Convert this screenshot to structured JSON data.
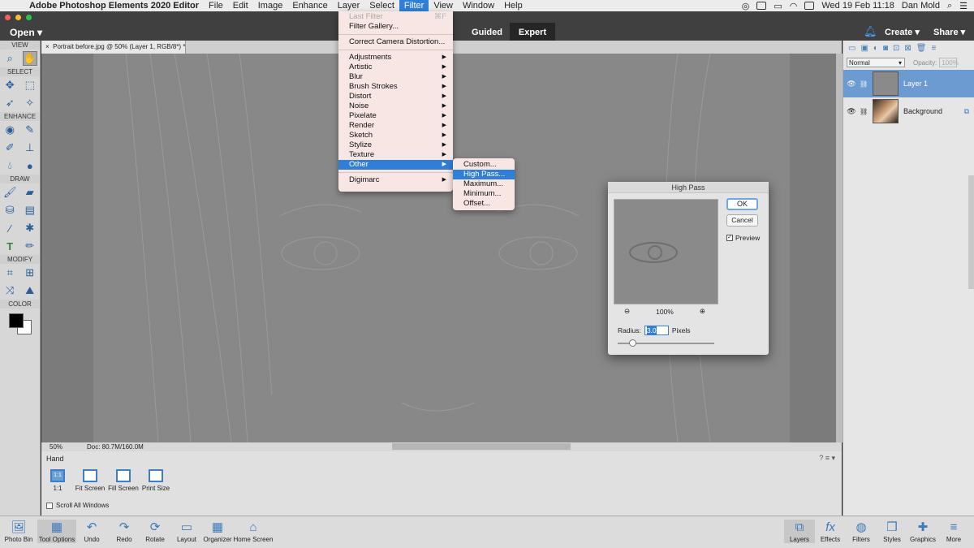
{
  "menubar": {
    "app_name": "Adobe Photoshop Elements 2020 Editor",
    "items": [
      "File",
      "Edit",
      "Image",
      "Enhance",
      "Layer",
      "Select",
      "Filter",
      "View",
      "Window",
      "Help"
    ],
    "active_item": "Filter",
    "datetime": "Wed 19 Feb  11:18",
    "user": "Dan Mold"
  },
  "topbar": {
    "open_label": "Open",
    "modes": [
      "Guided",
      "Expert"
    ],
    "active_mode": "Expert",
    "create_label": "Create",
    "share_label": "Share"
  },
  "toolbox": {
    "sections": [
      "VIEW",
      "SELECT",
      "ENHANCE",
      "DRAW",
      "MODIFY",
      "COLOR"
    ]
  },
  "document": {
    "tab_title": "Portrait before.jpg @ 50% (Layer 1, RGB/8*) *",
    "zoom": "50%",
    "doc_size": "Doc: 80.7M/160.0M"
  },
  "tool_options": {
    "tool_name": "Hand",
    "options": [
      "1:1",
      "Fit Screen",
      "Fill Screen",
      "Print Size"
    ],
    "scroll_all_label": "Scroll All Windows"
  },
  "layers_panel": {
    "blend_mode": "Normal",
    "opacity_label": "Opacity:",
    "opacity_value": "100%",
    "layers": [
      {
        "name": "Layer 1",
        "selected": true
      },
      {
        "name": "Background",
        "selected": false
      }
    ]
  },
  "taskbar": {
    "left": [
      "Photo Bin",
      "Tool Options",
      "Undo",
      "Redo",
      "Rotate",
      "Layout",
      "Organizer",
      "Home Screen"
    ],
    "right": [
      "Layers",
      "Effects",
      "Filters",
      "Styles",
      "Graphics",
      "More"
    ]
  },
  "filter_menu": {
    "last_filter": "Last Filter",
    "last_filter_shortcut": "⌘F",
    "filter_gallery": "Filter Gallery...",
    "correct_camera": "Correct Camera Distortion...",
    "categories": [
      "Adjustments",
      "Artistic",
      "Blur",
      "Brush Strokes",
      "Distort",
      "Noise",
      "Pixelate",
      "Render",
      "Sketch",
      "Stylize",
      "Texture",
      "Other"
    ],
    "highlighted": "Other",
    "digimarc": "Digimarc"
  },
  "other_submenu": {
    "items": [
      "Custom...",
      "High Pass...",
      "Maximum...",
      "Minimum...",
      "Offset..."
    ],
    "highlighted": "High Pass..."
  },
  "high_pass_dialog": {
    "title": "High Pass",
    "ok_label": "OK",
    "cancel_label": "Cancel",
    "preview_label": "Preview",
    "preview_checked": true,
    "zoom_level": "100%",
    "radius_label": "Radius:",
    "radius_value": "3.0",
    "radius_unit": "Pixels"
  },
  "colors": {
    "accent": "#2f7ed8",
    "selected_layer": "#6c9bd1",
    "menu_bg": "#f7e6e3"
  }
}
